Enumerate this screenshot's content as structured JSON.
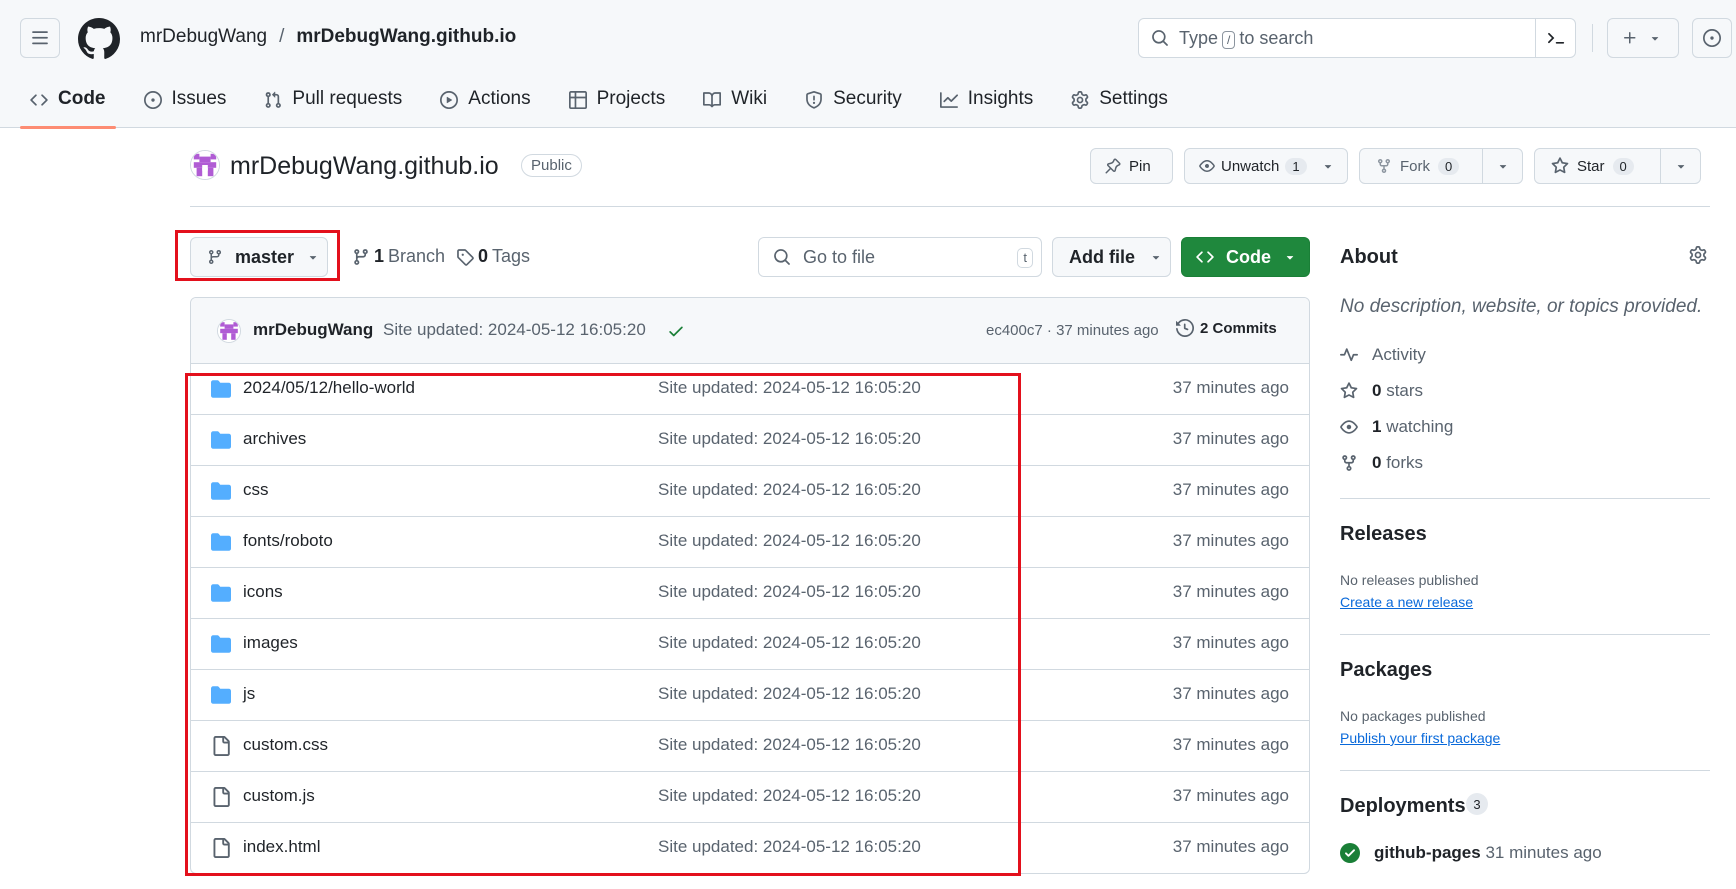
{
  "header": {
    "owner": "mrDebugWang",
    "separator": "/",
    "repo": "mrDebugWang.github.io",
    "search_prefix": "Type",
    "search_key": "/",
    "search_suffix": "to search"
  },
  "tabs": [
    {
      "label": "Code",
      "icon": "code-icon",
      "active": true
    },
    {
      "label": "Issues",
      "icon": "issue-opened-icon"
    },
    {
      "label": "Pull requests",
      "icon": "git-pull-request-icon"
    },
    {
      "label": "Actions",
      "icon": "play-icon"
    },
    {
      "label": "Projects",
      "icon": "table-icon"
    },
    {
      "label": "Wiki",
      "icon": "book-icon"
    },
    {
      "label": "Security",
      "icon": "shield-icon"
    },
    {
      "label": "Insights",
      "icon": "graph-icon"
    },
    {
      "label": "Settings",
      "icon": "gear-icon"
    }
  ],
  "repo": {
    "name": "mrDebugWang.github.io",
    "visibility": "Public",
    "pin_label": "Pin",
    "watch_label": "Unwatch",
    "watch_count": "1",
    "fork_label": "Fork",
    "fork_count": "0",
    "star_label": "Star",
    "star_count": "0"
  },
  "toolbar": {
    "branch": "master",
    "branch_count": "1",
    "branch_label": "Branch",
    "tag_count": "0",
    "tag_label": "Tags",
    "goto_placeholder": "Go to file",
    "goto_key": "t",
    "add_file_label": "Add file",
    "code_label": "Code"
  },
  "commit": {
    "author": "mrDebugWang",
    "message": "Site updated: 2024-05-12 16:05:20",
    "hash": "ec400c7",
    "dot": "·",
    "age": "37 minutes ago",
    "commits_label": "2 Commits"
  },
  "files": [
    {
      "name": "2024/05/12/hello-world",
      "type": "dir",
      "message": "Site updated: 2024-05-12 16:05:20",
      "age": "37 minutes ago"
    },
    {
      "name": "archives",
      "type": "dir",
      "message": "Site updated: 2024-05-12 16:05:20",
      "age": "37 minutes ago"
    },
    {
      "name": "css",
      "type": "dir",
      "message": "Site updated: 2024-05-12 16:05:20",
      "age": "37 minutes ago"
    },
    {
      "name": "fonts/roboto",
      "type": "dir",
      "message": "Site updated: 2024-05-12 16:05:20",
      "age": "37 minutes ago"
    },
    {
      "name": "icons",
      "type": "dir",
      "message": "Site updated: 2024-05-12 16:05:20",
      "age": "37 minutes ago"
    },
    {
      "name": "images",
      "type": "dir",
      "message": "Site updated: 2024-05-12 16:05:20",
      "age": "37 minutes ago"
    },
    {
      "name": "js",
      "type": "dir",
      "message": "Site updated: 2024-05-12 16:05:20",
      "age": "37 minutes ago"
    },
    {
      "name": "custom.css",
      "type": "file",
      "message": "Site updated: 2024-05-12 16:05:20",
      "age": "37 minutes ago"
    },
    {
      "name": "custom.js",
      "type": "file",
      "message": "Site updated: 2024-05-12 16:05:20",
      "age": "37 minutes ago"
    },
    {
      "name": "index.html",
      "type": "file",
      "message": "Site updated: 2024-05-12 16:05:20",
      "age": "37 minutes ago"
    }
  ],
  "sidebar": {
    "about_title": "About",
    "about_desc": "No description, website, or topics provided.",
    "activity_label": "Activity",
    "stars_count": "0",
    "stars_label": "stars",
    "watching_count": "1",
    "watching_label": "watching",
    "forks_count": "0",
    "forks_label": "forks",
    "releases_title": "Releases",
    "releases_note": "No releases published",
    "releases_link": "Create a new release",
    "packages_title": "Packages",
    "packages_note": "No packages published",
    "packages_link": "Publish your first package",
    "deployments_title": "Deployments",
    "deployments_count": "3",
    "deploy_name": "github-pages",
    "deploy_age": "31 minutes ago"
  },
  "colors": {
    "accent_green": "#1f883d",
    "highlight_red": "#e3101c",
    "folder_blue": "#54aeff",
    "tab_underline": "#fd8c73",
    "link_blue": "#0969da"
  }
}
